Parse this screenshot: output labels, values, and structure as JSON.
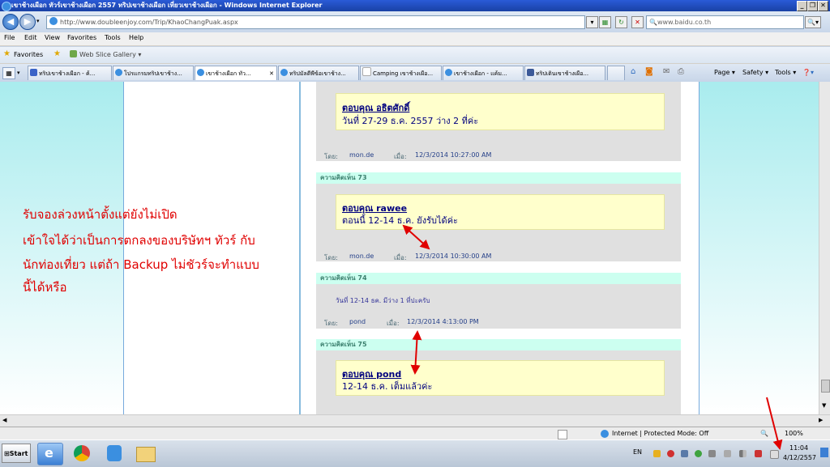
{
  "window": {
    "title": "เขาช้างเผือก ทัวร์เขาช้างเผือก 2557 ทริปเขาช้างเผือก เที่ยวเขาช้างเผือก - Windows Internet Explorer",
    "min": "_",
    "max": "❐",
    "close": "✕"
  },
  "address_bar": {
    "url": "http://www.doubleenjoy.com/Trip/KhaoChangPuak.aspx",
    "search_value": "www.baidu.co.th"
  },
  "menu": [
    "File",
    "Edit",
    "View",
    "Favorites",
    "Tools",
    "Help"
  ],
  "favorites": {
    "label": "Favorites",
    "web_slice": "Web Slice Gallery ▾"
  },
  "tabs": [
    {
      "label": "ทริปเขาช้างเผือก - ค้..."
    },
    {
      "label": "โปรแกรมทริปเขาช้าง..."
    },
    {
      "label": "เขาช้างเผือก ทัว..."
    },
    {
      "label": "ทริปมัลดีพีข้อเขาช้าง..."
    },
    {
      "label": "Camping เขาช้างเผือ..."
    },
    {
      "label": "เขาช้างเผือก - แค้ม..."
    },
    {
      "label": "ทริปเดินเขาช้างเผือ..."
    }
  ],
  "command_bar": {
    "page": "Page ▾",
    "safety": "Safety ▾",
    "tools": "Tools ▾",
    "help": "❓▾"
  },
  "annotation_lines": [
    "รับจองล่วงหน้าตั้งแต่ยังไม่เปิด",
    "เข้าใจได้ว่าเป็นการตกลงของบริษัทฯ ทัวร์ กับ",
    "นักท่องเที่ยว แต่ถ้า Backup ไม่ชัวร์จะทำแบบ",
    "นี้ได้หรือ"
  ],
  "comments": {
    "c1": {
      "reply_title": "ตอบคุณ อธิตศักดิ์",
      "reply_body": "วันที่ 27-29 ธ.ค. 2557 ว่าง 2 ที่ค่ะ",
      "by_label": "โดย:",
      "by": "mon.de",
      "when_label": "เมื่อ:",
      "when": "12/3/2014 10:27:00 AM"
    },
    "c73": {
      "header": "ความคิดเห็น 73",
      "reply_title": "ตอบคุณ rawee",
      "reply_body": "ตอนนี้ 12-14 ธ.ค. ยังรับได้ค่ะ",
      "by_label": "โดย:",
      "by": "mon.de",
      "when_label": "เมื่อ:",
      "when": "12/3/2014 10:30:00 AM"
    },
    "c74": {
      "header": "ความคิดเห็น 74",
      "body": "วันที่ 12-14 ธค. มีว่าง 1 ที่ปะครับ",
      "by_label": "โดย:",
      "by": "pond",
      "when_label": "เมื่อ:",
      "when": "12/3/2014 4:13:00 PM"
    },
    "c75": {
      "header": "ความคิดเห็น 75",
      "reply_title": "ตอบคุณ pond",
      "reply_body": "12-14 ธ.ค. เต็มแล้วค่ะ"
    }
  },
  "status_bar": {
    "zone": "Internet | Protected Mode: Off",
    "zoom": "100%"
  },
  "taskbar": {
    "start": "Start",
    "lang": "EN",
    "time": "11:04",
    "date": "4/12/2557"
  },
  "colors": {
    "annotation_red": "#e00000",
    "quote_bg": "#ffffcc",
    "comment_header_bg": "#ccfff0",
    "panel_bg": "#e0e0e0"
  }
}
